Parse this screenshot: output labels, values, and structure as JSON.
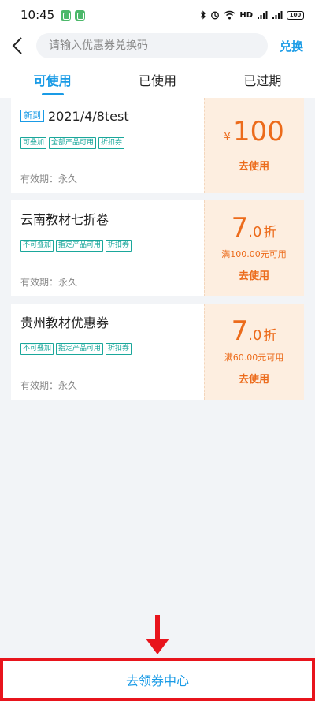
{
  "status_bar": {
    "time": "10:45",
    "network": "HD",
    "signal1": "4G",
    "signal2": "4G",
    "battery": "100",
    "icons": [
      "bluetooth-icon",
      "alarm-icon",
      "wifi-icon",
      "signal-icon",
      "battery-icon"
    ]
  },
  "header": {
    "search_placeholder": "请输入优惠券兑换码",
    "redeem_label": "兑换"
  },
  "tabs": [
    {
      "label": "可使用",
      "active": true
    },
    {
      "label": "已使用",
      "active": false
    },
    {
      "label": "已过期",
      "active": false
    }
  ],
  "coupons": [
    {
      "badge": "新到",
      "title": "2021/4/8test",
      "tags": [
        "可叠加",
        "全部产品可用",
        "折扣券"
      ],
      "validity": "有效期：永久",
      "currency": "¥",
      "amount": "100",
      "threshold": "",
      "action": "去使用"
    },
    {
      "badge": "",
      "title": "云南教材七折卷",
      "tags": [
        "不可叠加",
        "指定产品可用",
        "折扣券"
      ],
      "validity": "有效期：永久",
      "amount_int": "7",
      "amount_dec": ".0",
      "unit": "折",
      "threshold": "满100.00元可用",
      "action": "去使用"
    },
    {
      "badge": "",
      "title": "贵州教材优惠券",
      "tags": [
        "不可叠加",
        "指定产品可用",
        "折扣券"
      ],
      "validity": "有效期：永久",
      "amount_int": "7",
      "amount_dec": ".0",
      "unit": "折",
      "threshold": "满60.00元可用",
      "action": "去使用"
    }
  ],
  "bottom": {
    "label": "去领券中心"
  },
  "colors": {
    "accent": "#1a9be6",
    "orange": "#ec6b1b",
    "tag_teal": "#1aa79b",
    "annotation_red": "#e8141c"
  }
}
